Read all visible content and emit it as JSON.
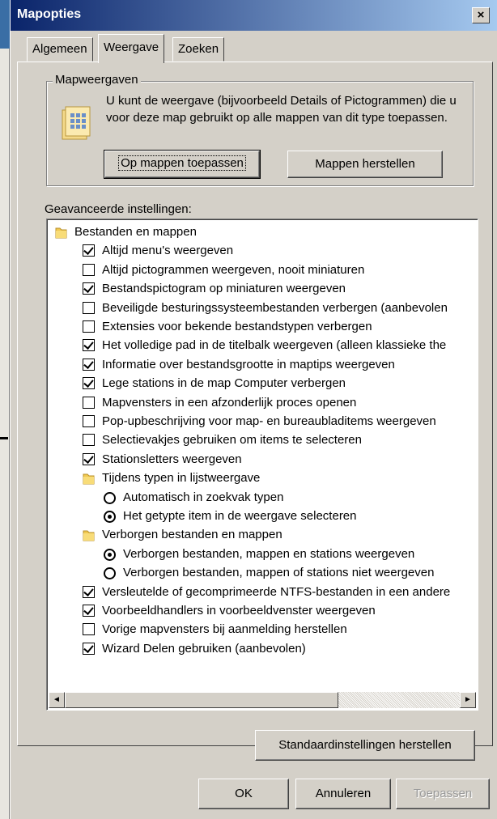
{
  "window": {
    "title": "Mapopties",
    "close": "×"
  },
  "tabs": [
    "Algemeen",
    "Weergave",
    "Zoeken"
  ],
  "group": {
    "label": "Mapweergaven",
    "description": "U kunt de weergave (bijvoorbeeld Details of Pictogrammen) die u voor deze map gebruikt op alle mappen van dit type toepassen.",
    "apply_button": "Op mappen toepassen",
    "reset_button": "Mappen herstellen"
  },
  "advanced_label": "Geavanceerde instellingen:",
  "tree": [
    {
      "kind": "folder",
      "indent": 0,
      "label": "Bestanden en mappen"
    },
    {
      "kind": "checkbox",
      "indent": 1,
      "checked": true,
      "label": "Altijd menu's weergeven"
    },
    {
      "kind": "checkbox",
      "indent": 1,
      "checked": false,
      "label": "Altijd pictogrammen weergeven, nooit miniaturen"
    },
    {
      "kind": "checkbox",
      "indent": 1,
      "checked": true,
      "label": "Bestandspictogram op miniaturen weergeven"
    },
    {
      "kind": "checkbox",
      "indent": 1,
      "checked": false,
      "label": "Beveiligde besturingssysteembestanden verbergen (aanbevolen"
    },
    {
      "kind": "checkbox",
      "indent": 1,
      "checked": false,
      "label": "Extensies voor bekende bestandstypen verbergen"
    },
    {
      "kind": "checkbox",
      "indent": 1,
      "checked": true,
      "label": "Het volledige pad in de titelbalk weergeven (alleen klassieke the"
    },
    {
      "kind": "checkbox",
      "indent": 1,
      "checked": true,
      "label": "Informatie over bestandsgrootte in maptips weergeven"
    },
    {
      "kind": "checkbox",
      "indent": 1,
      "checked": true,
      "label": "Lege stations in de map Computer verbergen"
    },
    {
      "kind": "checkbox",
      "indent": 1,
      "checked": false,
      "label": "Mapvensters in een afzonderlijk proces openen"
    },
    {
      "kind": "checkbox",
      "indent": 1,
      "checked": false,
      "label": "Pop-upbeschrijving voor map- en bureaubladitems weergeven"
    },
    {
      "kind": "checkbox",
      "indent": 1,
      "checked": false,
      "label": "Selectievakjes gebruiken om items te selecteren"
    },
    {
      "kind": "checkbox",
      "indent": 1,
      "checked": true,
      "label": "Stationsletters weergeven"
    },
    {
      "kind": "folder",
      "indent": 1,
      "label": "Tijdens typen in lijstweergave"
    },
    {
      "kind": "radio",
      "indent": 2,
      "checked": false,
      "label": "Automatisch in zoekvak typen"
    },
    {
      "kind": "radio",
      "indent": 2,
      "checked": true,
      "label": "Het getypte item in de weergave selecteren"
    },
    {
      "kind": "folder",
      "indent": 1,
      "label": "Verborgen bestanden en mappen"
    },
    {
      "kind": "radio",
      "indent": 2,
      "checked": true,
      "label": "Verborgen bestanden, mappen en stations weergeven"
    },
    {
      "kind": "radio",
      "indent": 2,
      "checked": false,
      "label": "Verborgen bestanden, mappen of stations niet weergeven"
    },
    {
      "kind": "checkbox",
      "indent": 1,
      "checked": true,
      "label": "Versleutelde of gecomprimeerde NTFS-bestanden in een andere"
    },
    {
      "kind": "checkbox",
      "indent": 1,
      "checked": true,
      "label": "Voorbeeldhandlers in voorbeeldvenster weergeven"
    },
    {
      "kind": "checkbox",
      "indent": 1,
      "checked": false,
      "label": "Vorige mapvensters bij aanmelding herstellen"
    },
    {
      "kind": "checkbox",
      "indent": 1,
      "checked": true,
      "label": "Wizard Delen gebruiken (aanbevolen)"
    }
  ],
  "scrollbar": {
    "left_arrow": "◄",
    "right_arrow": "►"
  },
  "restore_defaults": "Standaardinstellingen herstellen",
  "footer": {
    "ok": "OK",
    "cancel": "Annuleren",
    "apply": "Toepassen"
  }
}
